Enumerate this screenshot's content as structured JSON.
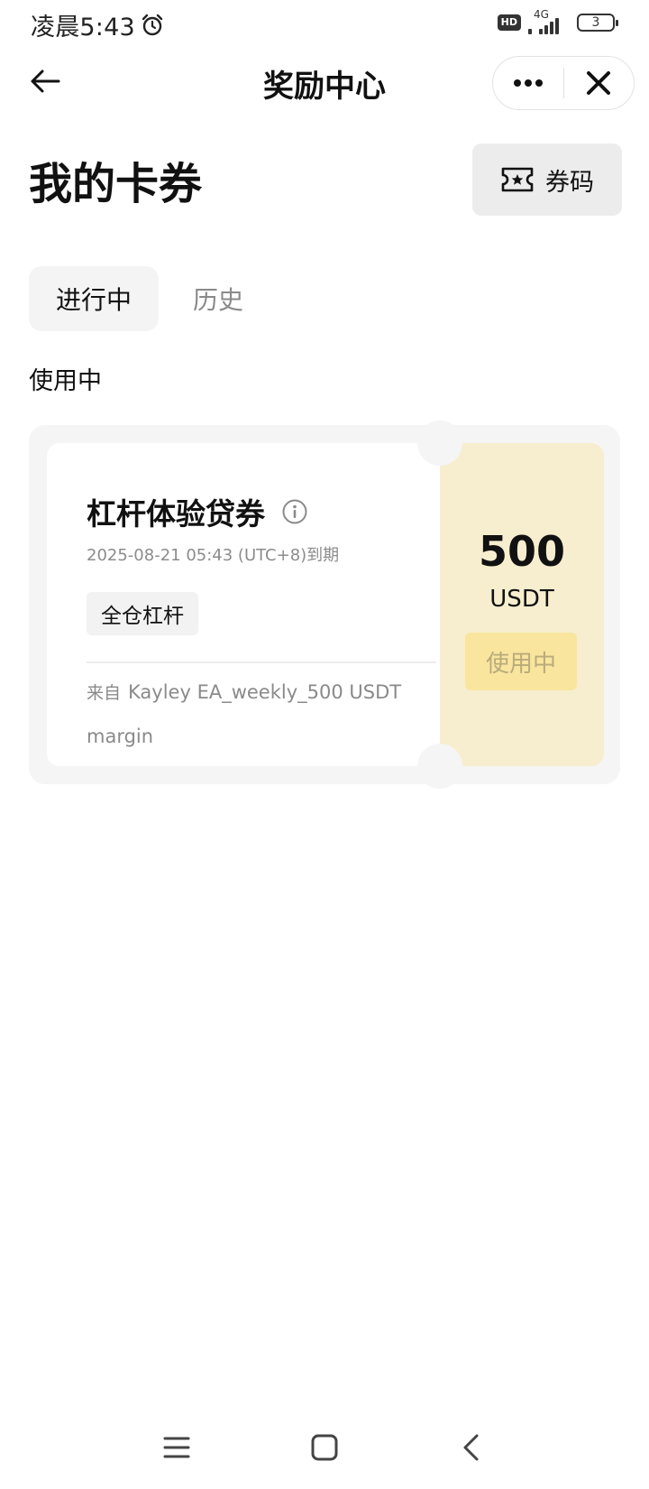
{
  "status_bar": {
    "time": "凌晨5:43",
    "hd": "HD",
    "network": "4G",
    "battery": "3"
  },
  "nav": {
    "title": "奖励中心"
  },
  "header": {
    "title": "我的卡券",
    "code_button_label": "券码"
  },
  "tabs": [
    {
      "label": "进行中",
      "active": true
    },
    {
      "label": "历史",
      "active": false
    }
  ],
  "section_label": "使用中",
  "coupon": {
    "name": "杠杆体验贷券",
    "expiry": "2025-08-21 05:43 (UTC+8)到期",
    "tag": "全仓杠杆",
    "source_prefix": "来自",
    "source": "Kayley EA_weekly_500 USDT margin",
    "amount": "500",
    "unit": "USDT",
    "status_button": "使用中"
  },
  "colors": {
    "accent_panel": "#f7eecf",
    "use_button": "#f9e59e",
    "use_button_text": "#b9ab7a"
  },
  "icons": {
    "back": "arrow-left-icon",
    "more": "more-dots-icon",
    "close": "close-icon",
    "code": "ticket-star-icon",
    "info": "info-icon",
    "alarm": "alarm-clock-icon"
  }
}
